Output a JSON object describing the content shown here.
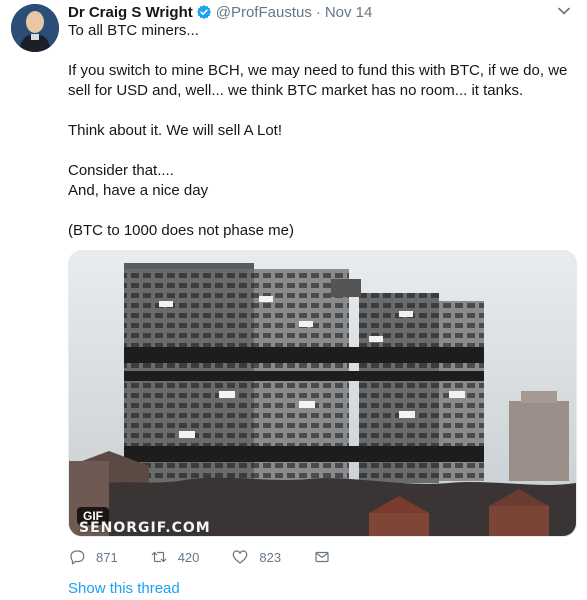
{
  "tweet": {
    "name": "Dr Craig S Wright",
    "handle": "@ProfFaustus",
    "separator": "·",
    "date": "Nov 14",
    "paragraphs": [
      "To all BTC miners...",
      "If you switch to mine BCH, we may need to fund this with BTC, if we do, we sell for USD and, well... we think BTC market has no room... it tanks.",
      "Think about it. We will sell A Lot!",
      "Consider that....",
      "And, have a nice day",
      "(BTC to 1000 does not phase me)"
    ],
    "media": {
      "badge": "GIF",
      "watermark": "SENORGIF.COM"
    },
    "actions": {
      "reply_count": "871",
      "retweet_count": "420",
      "like_count": "823"
    },
    "show_thread": "Show this thread",
    "icons": [
      "verified-badge-icon",
      "chevron-down-icon",
      "reply-icon",
      "retweet-icon",
      "like-icon",
      "direct-message-icon"
    ],
    "colors": {
      "link": "#1da1f2",
      "muted": "#657786",
      "text": "#14171a"
    }
  }
}
